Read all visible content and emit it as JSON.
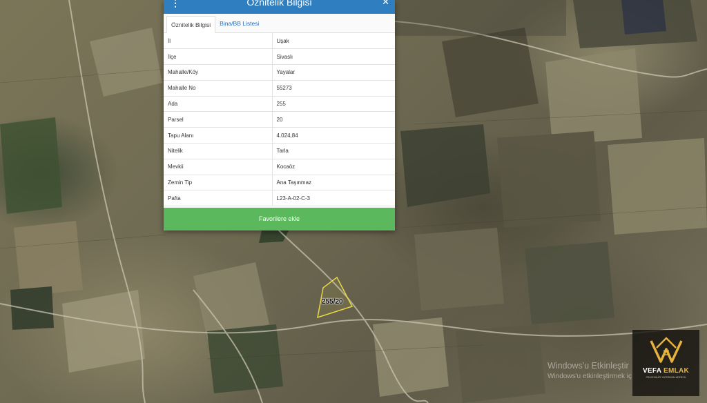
{
  "panel": {
    "title": "Öznitelik Bilgisi",
    "tabs": [
      {
        "label": "Öznitelik Bilgisi",
        "active": true
      },
      {
        "label": "Bina/BB Listesi",
        "active": false
      }
    ],
    "rows": [
      {
        "key": "İl",
        "value": "Uşak"
      },
      {
        "key": "İlçe",
        "value": "Sivaslı"
      },
      {
        "key": "Mahalle/Köy",
        "value": "Yayalar"
      },
      {
        "key": "Mahalle No",
        "value": "55273"
      },
      {
        "key": "Ada",
        "value": "255"
      },
      {
        "key": "Parsel",
        "value": "20"
      },
      {
        "key": "Tapu Alanı",
        "value": "4.024,84"
      },
      {
        "key": "Nitelik",
        "value": "Tarla"
      },
      {
        "key": "Mevkii",
        "value": "Kocaöz"
      },
      {
        "key": "Zemin Tip",
        "value": "Ana Taşınmaz"
      },
      {
        "key": "Pafta",
        "value": "L23-A-02-C-3"
      }
    ],
    "favorite_button": "Favorilere ekle"
  },
  "map": {
    "parcel_label": "255/20",
    "parcel_outline_color": "#e8d64a"
  },
  "watermark": {
    "line1": "Windows'u Etkinleştir",
    "line2": "Windows'u etkinleştirmek iç"
  },
  "logo": {
    "brand_part1": "VEFA ",
    "brand_part2": "EMLAK",
    "tagline": "GÜVENİLİR YATIRIMIN ADRESİ"
  },
  "colors": {
    "header": "#2f7fc0",
    "button": "#5cb85c",
    "link": "#2a6db5",
    "logo_gold": "#e7b23d"
  }
}
